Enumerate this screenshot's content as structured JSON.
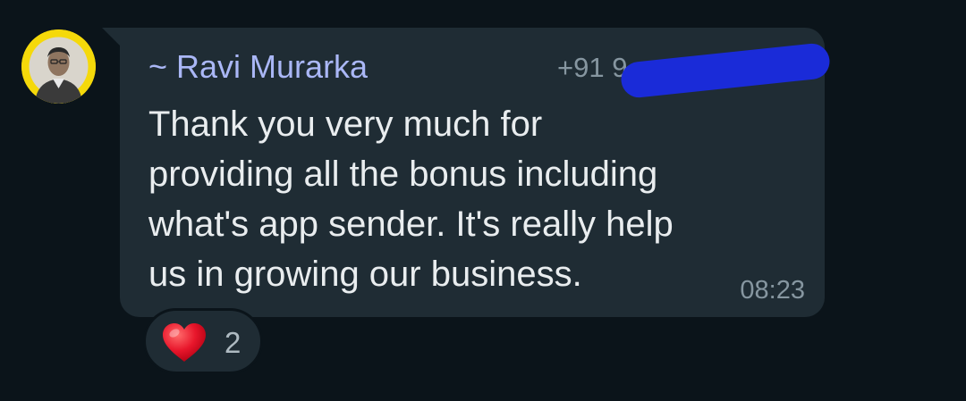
{
  "message": {
    "sender_name": "~ Ravi Murarka",
    "sender_phone": "+91 9",
    "text": "Thank you very much for\nproviding all the bonus including\nwhat's app sender. It's really help\nus in growing our business.",
    "time": "08:23"
  },
  "reaction": {
    "emoji": "heart-icon",
    "count": "2"
  },
  "colors": {
    "background": "#0b141a",
    "bubble": "#1f2c34",
    "sender_name": "#aab7f6",
    "text": "#e9edef",
    "meta": "#8696a0",
    "avatar_ring": "#f5d90a",
    "redaction": "#1a2bd8"
  }
}
